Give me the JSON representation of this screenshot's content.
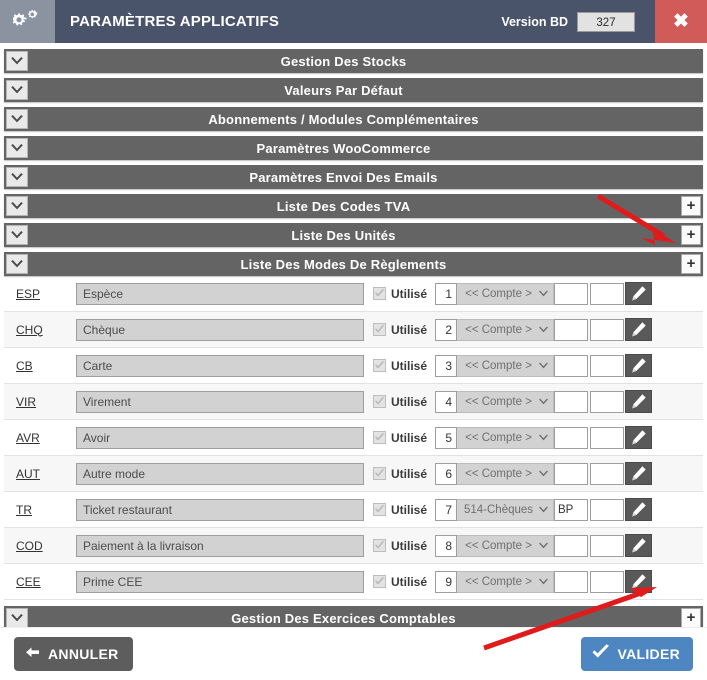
{
  "window": {
    "title": "PARAMÈTRES APPLICATIFS",
    "gear_icon": "gears-icon",
    "version_label": "Version BD",
    "version_value": "327",
    "close_icon": "✖",
    "titlebar_color": "#49536a",
    "close_color": "#d05b58"
  },
  "sections_top": [
    {
      "title": "Gestion Des Stocks",
      "has_add": false,
      "collapse_icon": "chevron-down-icon"
    },
    {
      "title": "Valeurs Par Défaut",
      "has_add": false,
      "collapse_icon": "chevron-down-icon"
    },
    {
      "title": "Abonnements / Modules Complémentaires",
      "has_add": false,
      "collapse_icon": "chevron-down-icon"
    },
    {
      "title": "Paramètres WooCommerce",
      "has_add": false,
      "collapse_icon": "chevron-down-icon"
    },
    {
      "title": "Paramètres Envoi Des Emails",
      "has_add": false,
      "collapse_icon": "chevron-down-icon"
    },
    {
      "title": "Liste Des Codes TVA",
      "has_add": true,
      "add_label": "+",
      "collapse_icon": "chevron-down-icon"
    },
    {
      "title": "Liste Des Unités",
      "has_add": true,
      "add_label": "+",
      "collapse_icon": "chevron-down-icon"
    },
    {
      "title": "Liste Des Modes De Règlements",
      "has_add": true,
      "add_label": "+",
      "collapse_icon": "chevron-down-icon"
    }
  ],
  "sections_bottom": [
    {
      "title": "Gestion Des Exercices Comptables",
      "has_add": true,
      "add_label": "+",
      "collapse_icon": "chevron-down-icon"
    }
  ],
  "payment_rows": {
    "checkbox_label": "Utilisé",
    "account_placeholder": "<< Compte >",
    "edit_icon": "pencil-icon",
    "items": [
      {
        "code": "ESP",
        "name": "Espèce",
        "used": true,
        "order": "1",
        "account": "<< Compte >",
        "field1": "",
        "field2": ""
      },
      {
        "code": "CHQ",
        "name": "Chèque",
        "used": true,
        "order": "2",
        "account": "<< Compte >",
        "field1": "",
        "field2": ""
      },
      {
        "code": "CB",
        "name": "Carte",
        "used": true,
        "order": "3",
        "account": "<< Compte >",
        "field1": "",
        "field2": ""
      },
      {
        "code": "VIR",
        "name": "Virement",
        "used": true,
        "order": "4",
        "account": "<< Compte >",
        "field1": "",
        "field2": ""
      },
      {
        "code": "AVR",
        "name": "Avoir",
        "used": true,
        "order": "5",
        "account": "<< Compte >",
        "field1": "",
        "field2": ""
      },
      {
        "code": "AUT",
        "name": "Autre mode",
        "used": true,
        "order": "6",
        "account": "<< Compte >",
        "field1": "",
        "field2": ""
      },
      {
        "code": "TR",
        "name": "Ticket restaurant",
        "used": true,
        "order": "7",
        "account": "514-Chèques",
        "field1": "BP",
        "field2": ""
      },
      {
        "code": "COD",
        "name": "Paiement à la livraison",
        "used": true,
        "order": "8",
        "account": "<< Compte >",
        "field1": "",
        "field2": ""
      },
      {
        "code": "CEE",
        "name": "Prime CEE",
        "used": true,
        "order": "9",
        "account": "<< Compte >",
        "field1": "",
        "field2": ""
      }
    ]
  },
  "footer": {
    "cancel_label": "ANNULER",
    "cancel_icon": "back-arrow-icon",
    "validate_label": "VALIDER",
    "validate_icon": "check-icon",
    "validate_color": "#4d86c0"
  },
  "annotations": {
    "color": "#e01b1b",
    "arrow_1": "arrow pointing to add button of Liste Des Unités",
    "arrow_2": "arrow pointing to edit pencil of CEE row"
  }
}
